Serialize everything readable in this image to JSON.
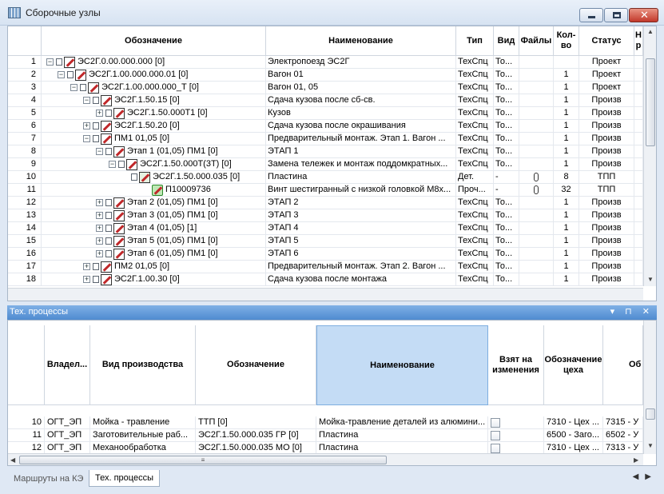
{
  "window": {
    "title": "Сборочные узлы"
  },
  "grid1": {
    "headers": {
      "designation": "Обозначение",
      "name": "Наименование",
      "type": "Тип",
      "kind": "Вид",
      "files": "Файлы",
      "qty": "Кол-во",
      "status": "Статус",
      "extra": "Н р"
    },
    "rows": [
      {
        "n": "1",
        "d": "ЭС2Г.0.00.000.000 [0]",
        "name": "Электропоезд ЭС2Г",
        "type": "ТехСпц",
        "kind": "То...",
        "qty": "",
        "status": "Проект"
      },
      {
        "n": "2",
        "d": "ЭС2Г.1.00.000.000.01 [0]",
        "name": "Вагон 01",
        "type": "ТехСпц",
        "kind": "То...",
        "qty": "1",
        "status": "Проект"
      },
      {
        "n": "3",
        "d": "ЭС2Г.1.00.000.000_Т [0]",
        "name": "Вагон 01, 05",
        "type": "ТехСпц",
        "kind": "То...",
        "qty": "1",
        "status": "Проект"
      },
      {
        "n": "4",
        "d": "ЭС2Г.1.50.15 [0]",
        "name": "Сдача кузова после сб-св.",
        "type": "ТехСпц",
        "kind": "То...",
        "qty": "1",
        "status": "Произв"
      },
      {
        "n": "5",
        "d": "ЭС2Г.1.50.000Т1 [0]",
        "name": "Кузов",
        "type": "ТехСпц",
        "kind": "То...",
        "qty": "1",
        "status": "Произв"
      },
      {
        "n": "6",
        "d": "ЭС2Г.1.50.20 [0]",
        "name": "Сдача кузова после окрашивания",
        "type": "ТехСпц",
        "kind": "То...",
        "qty": "1",
        "status": "Произв"
      },
      {
        "n": "7",
        "d": "ПМ1 01,05 [0]",
        "name": "Предварительный монтаж. Этап 1. Вагон ...",
        "type": "ТехСпц",
        "kind": "То...",
        "qty": "1",
        "status": "Произв"
      },
      {
        "n": "8",
        "d": "Этап 1 (01,05) ПМ1 [0]",
        "name": "ЭТАП 1",
        "type": "ТехСпц",
        "kind": "То...",
        "qty": "1",
        "status": "Произв"
      },
      {
        "n": "9",
        "d": "ЭС2Г.1.50.000Т(3Т) [0]",
        "name": "Замена тележек и монтаж поддомкратных...",
        "type": "ТехСпц",
        "kind": "То...",
        "qty": "1",
        "status": "Произв"
      },
      {
        "n": "10",
        "d": "ЭС2Г.1.50.000.035 [0]",
        "name": "Пластина",
        "type": "Дет.",
        "kind": "-",
        "qty": "8",
        "status": "ТПП"
      },
      {
        "n": "11",
        "d": "П10009736",
        "name": "Винт шестигранный с низкой головкой М8х...",
        "type": "Проч...",
        "kind": "-",
        "qty": "32",
        "status": "ТПП"
      },
      {
        "n": "12",
        "d": "Этап 2 (01,05) ПМ1 [0]",
        "name": "ЭТАП 2",
        "type": "ТехСпц",
        "kind": "То...",
        "qty": "1",
        "status": "Произв"
      },
      {
        "n": "13",
        "d": "Этап 3 (01,05) ПМ1 [0]",
        "name": "ЭТАП 3",
        "type": "ТехСпц",
        "kind": "То...",
        "qty": "1",
        "status": "Произв"
      },
      {
        "n": "14",
        "d": "Этап 4 (01,05) [1]",
        "name": "ЭТАП 4",
        "type": "ТехСпц",
        "kind": "То...",
        "qty": "1",
        "status": "Произв"
      },
      {
        "n": "15",
        "d": "Этап 5 (01,05) ПМ1 [0]",
        "name": "ЭТАП 5",
        "type": "ТехСпц",
        "kind": "То...",
        "qty": "1",
        "status": "Произв"
      },
      {
        "n": "16",
        "d": "Этап 6 (01,05) ПМ1 [0]",
        "name": "ЭТАП 6",
        "type": "ТехСпц",
        "kind": "То...",
        "qty": "1",
        "status": "Произв"
      },
      {
        "n": "17",
        "d": "ПМ2 01,05 [0]",
        "name": "Предварительный монтаж. Этап 2. Вагон ...",
        "type": "ТехСпц",
        "kind": "То...",
        "qty": "1",
        "status": "Произв"
      },
      {
        "n": "18",
        "d": "ЭС2Г.1.00.30 [0]",
        "name": "Сдача кузова после монтажа",
        "type": "ТехСпц",
        "kind": "То...",
        "qty": "1",
        "status": "Произв"
      }
    ]
  },
  "panel": {
    "title": "Тех. процессы",
    "icons": "▾ ⊓ ✕"
  },
  "grid2": {
    "headers": {
      "owner": "Владел...",
      "prodtype": "Вид производства",
      "designation": "Обозначение",
      "name": "Наименование",
      "taken": "Взят на изменения",
      "shop": "Обозначение цеха",
      "extra": "Об"
    },
    "rows": [
      {
        "n": "10",
        "owner": "ОГТ_ЭП",
        "prodtype": "Мойка - травление",
        "d": "ТТП [0]",
        "name": "Мойка-травление деталей из алюмини...",
        "shop": "7310 - Цех ...",
        "extra": "7315 - У"
      },
      {
        "n": "11",
        "owner": "ОГТ_ЭП",
        "prodtype": "Заготовительные раб...",
        "d": "ЭС2Г.1.50.000.035 ГР [0]",
        "name": "Пластина",
        "shop": "6500 - Заго...",
        "extra": "6502 - У"
      },
      {
        "n": "12",
        "owner": "ОГТ_ЭП",
        "prodtype": "Механообработка",
        "d": "ЭС2Г.1.50.000.035 МО [0]",
        "name": "Пластина",
        "shop": "7310 - Цех ...",
        "extra": "7313 - У"
      }
    ]
  },
  "tabs": [
    {
      "label": "Маршруты на КЭ",
      "active": false
    },
    {
      "label": "Тех. процессы",
      "active": true
    }
  ]
}
